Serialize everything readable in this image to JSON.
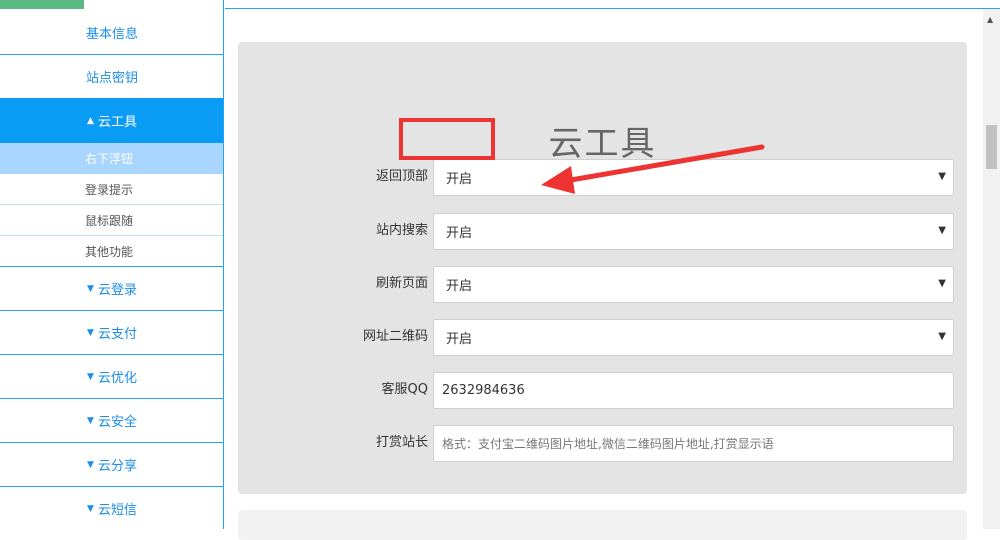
{
  "sidebar": {
    "items": [
      {
        "label": "基本信息"
      },
      {
        "label": "站点密钥"
      },
      {
        "label": "云工具",
        "caret": "▲"
      },
      {
        "label": "云登录",
        "caret": "▼"
      },
      {
        "label": "云支付",
        "caret": "▼"
      },
      {
        "label": "云优化",
        "caret": "▼"
      },
      {
        "label": "云安全",
        "caret": "▼"
      },
      {
        "label": "云分享",
        "caret": "▼"
      },
      {
        "label": "云短信",
        "caret": "▼"
      }
    ],
    "subitems": [
      {
        "label": "右下浮钮"
      },
      {
        "label": "登录提示"
      },
      {
        "label": "鼠标跟随"
      },
      {
        "label": "其他功能"
      }
    ]
  },
  "panel": {
    "title": "云工具",
    "fields": [
      {
        "label": "返回顶部",
        "value": "开启",
        "type": "select"
      },
      {
        "label": "站内搜索",
        "value": "开启",
        "type": "select"
      },
      {
        "label": "刷新页面",
        "value": "开启",
        "type": "select"
      },
      {
        "label": "网址二维码",
        "value": "开启",
        "type": "select"
      },
      {
        "label": "客服QQ",
        "value": "2632984636",
        "type": "input"
      },
      {
        "label": "打赏站长",
        "placeholder": "格式：支付宝二维码图片地址,微信二维码图片地址,打赏显示语",
        "type": "input"
      }
    ],
    "select_arrow": "▼"
  },
  "colors": {
    "accent": "#0a9bf4",
    "sidebar_text": "#1a8ee8",
    "annotation": "#ee3333",
    "top_accent": "#5bb982"
  },
  "scrollbar": {
    "up_arrow": "▲"
  }
}
